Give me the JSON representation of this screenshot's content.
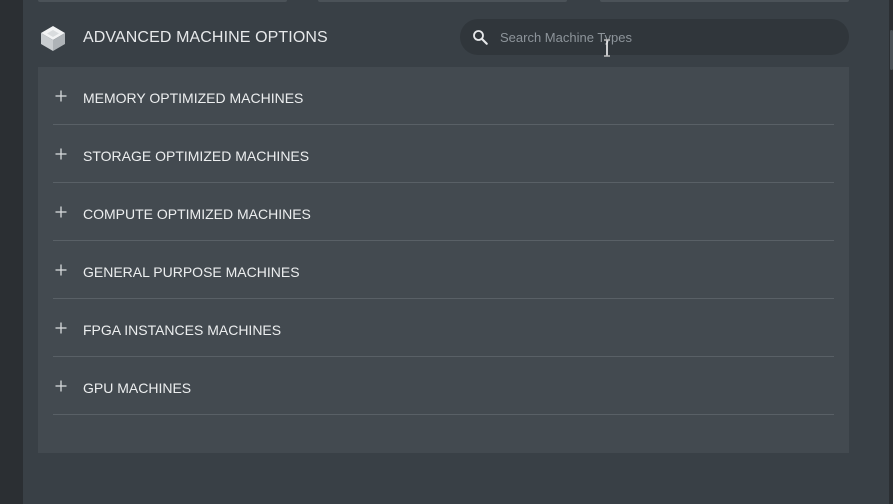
{
  "header": {
    "title": "ADVANCED MACHINE OPTIONS",
    "icon": "cube-icon"
  },
  "search": {
    "placeholder": "Search Machine Types",
    "value": "",
    "icon": "search-icon"
  },
  "machine_categories": [
    {
      "label": "MEMORY OPTIMIZED MACHINES",
      "expanded": false
    },
    {
      "label": "STORAGE OPTIMIZED MACHINES",
      "expanded": false
    },
    {
      "label": "COMPUTE OPTIMIZED MACHINES",
      "expanded": false
    },
    {
      "label": "GENERAL PURPOSE MACHINES",
      "expanded": false
    },
    {
      "label": "FPGA INSTANCES MACHINES",
      "expanded": false
    },
    {
      "label": "GPU MACHINES",
      "expanded": false
    }
  ],
  "colors": {
    "background": "#2b2f33",
    "panel": "#394046",
    "list_panel": "#434a50",
    "search_bg": "#30363b",
    "text": "#eceeef",
    "muted_text": "#8d949a",
    "divider": "#596066"
  }
}
